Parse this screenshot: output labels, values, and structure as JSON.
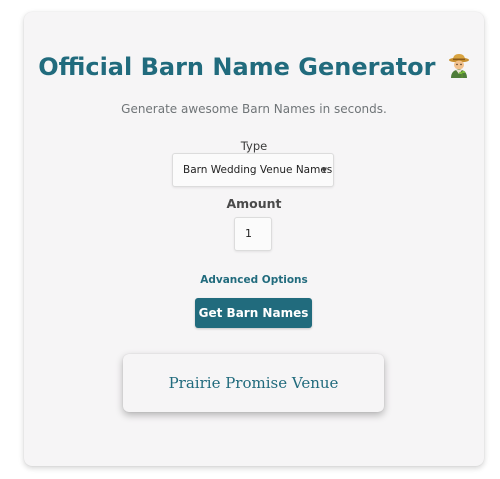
{
  "header": {
    "title": "Official Barn Name Generator",
    "title_icon": "farmer-emoji",
    "subtitle": "Generate awesome Barn Names in seconds."
  },
  "form": {
    "type_label": "Type",
    "type_selected": "Barn Wedding Venue Names",
    "amount_label": "Amount",
    "amount_value": "1",
    "advanced_options": "Advanced Options",
    "submit_label": "Get Barn Names"
  },
  "results": [
    "Prairie Promise Venue"
  ],
  "colors": {
    "accent": "#216b7d",
    "card_background": "#f6f5f6"
  }
}
